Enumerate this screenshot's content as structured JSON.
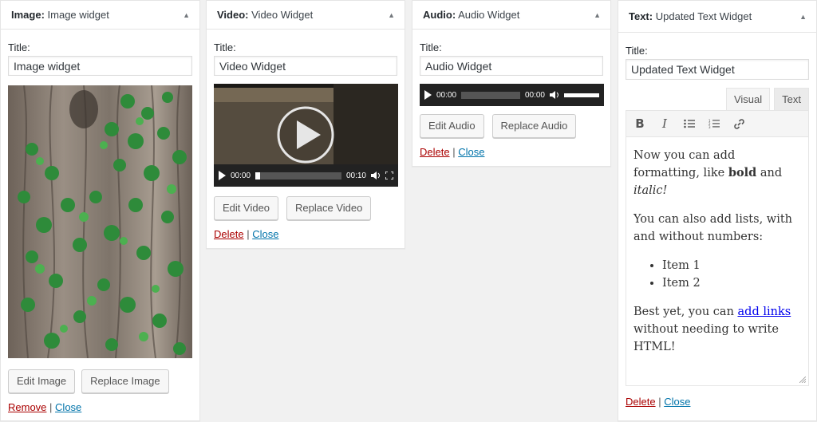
{
  "image_widget": {
    "type": "Image:",
    "title": "Image widget",
    "title_label": "Title:",
    "title_value": "Image widget",
    "edit_label": "Edit Image",
    "replace_label": "Replace Image",
    "remove_label": "Remove",
    "close_label": "Close"
  },
  "video_widget": {
    "type": "Video:",
    "title": "Video Widget",
    "title_label": "Title:",
    "title_value": "Video Widget",
    "current_time": "00:00",
    "duration": "00:10",
    "edit_label": "Edit Video",
    "replace_label": "Replace Video",
    "delete_label": "Delete",
    "close_label": "Close"
  },
  "audio_widget": {
    "type": "Audio:",
    "title": "Audio Widget",
    "title_label": "Title:",
    "title_value": "Audio Widget",
    "current_time": "00:00",
    "duration": "00:00",
    "edit_label": "Edit Audio",
    "replace_label": "Replace Audio",
    "delete_label": "Delete",
    "close_label": "Close"
  },
  "text_widget": {
    "type": "Text:",
    "title": "Updated Text Widget",
    "title_label": "Title:",
    "title_value": "Updated Text Widget",
    "tab_visual": "Visual",
    "tab_text": "Text",
    "content": {
      "p1_a": "Now you can add formatting, like ",
      "p1_bold": "bold",
      "p1_b": " and ",
      "p1_italic": "italic!",
      "p2": "You can also add lists, with and without numbers:",
      "items": [
        "Item 1",
        "Item 2"
      ],
      "p3_a": "Best yet, you can ",
      "p3_link": "add links",
      "p3_b": " without needing to write HTML!"
    },
    "delete_label": "Delete",
    "close_label": "Close"
  },
  "colors": {
    "delete": "#aa0000",
    "link": "#0073aa",
    "player_bg": "#222222"
  }
}
